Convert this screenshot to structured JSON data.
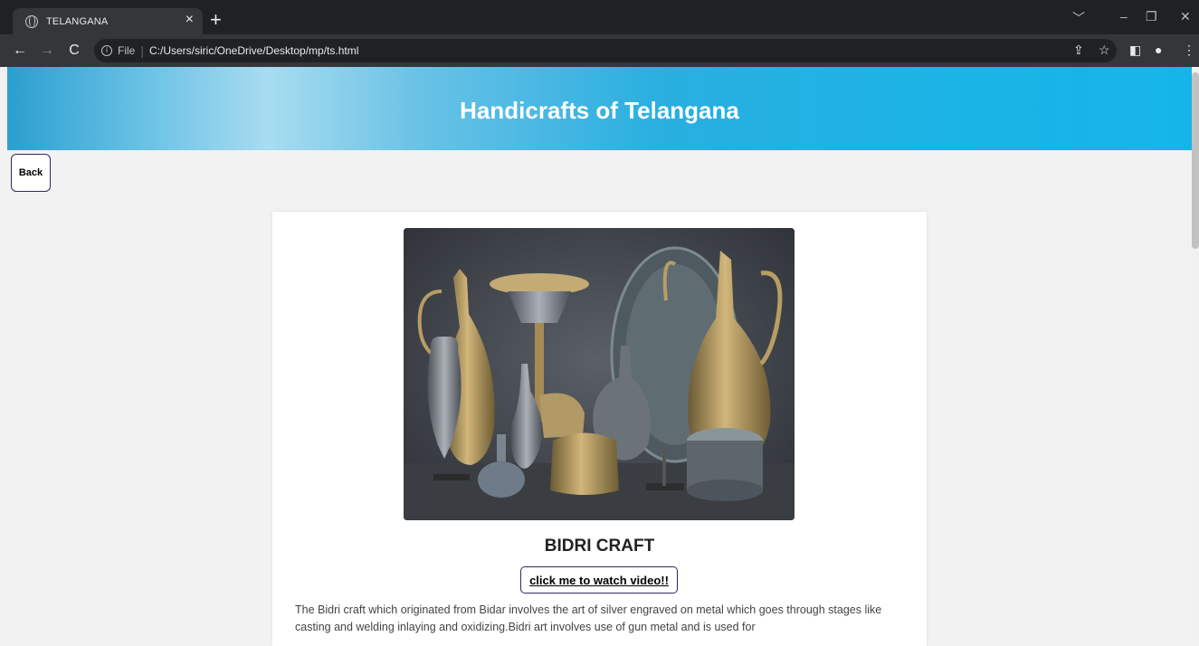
{
  "browser": {
    "tab_title": "TELANGANA",
    "tab_close": "×",
    "new_tab": "+",
    "file_label": "File",
    "separator": "|",
    "url": "C:/Users/siric/OneDrive/Desktop/mp/ts.html",
    "icons": [
      "globe-icon",
      "close-icon",
      "new-tab-icon",
      "back-arrow-icon",
      "forward-arrow-icon",
      "reload-icon",
      "info-icon",
      "share-icon",
      "star-icon",
      "sidebar-icon",
      "profile-icon",
      "menu-icon",
      "chevron-down-icon",
      "minimize-icon",
      "restore-icon",
      "close-window-icon"
    ]
  },
  "page": {
    "header_title": "Handicrafts of Telangana",
    "back_label": "Back",
    "craft": {
      "title": "BIDRI CRAFT",
      "video_link": "click me to watch video!!",
      "description": "The Bidri craft which originated from Bidar involves the art of silver engraved on metal which goes through stages like casting and welding inlaying and oxidizing.Bidri art involves use of gun metal and is used for"
    }
  },
  "colors": {
    "header_accent": "#16b5e9",
    "button_border": "#2c2a66",
    "browser_dark": "#202124"
  }
}
